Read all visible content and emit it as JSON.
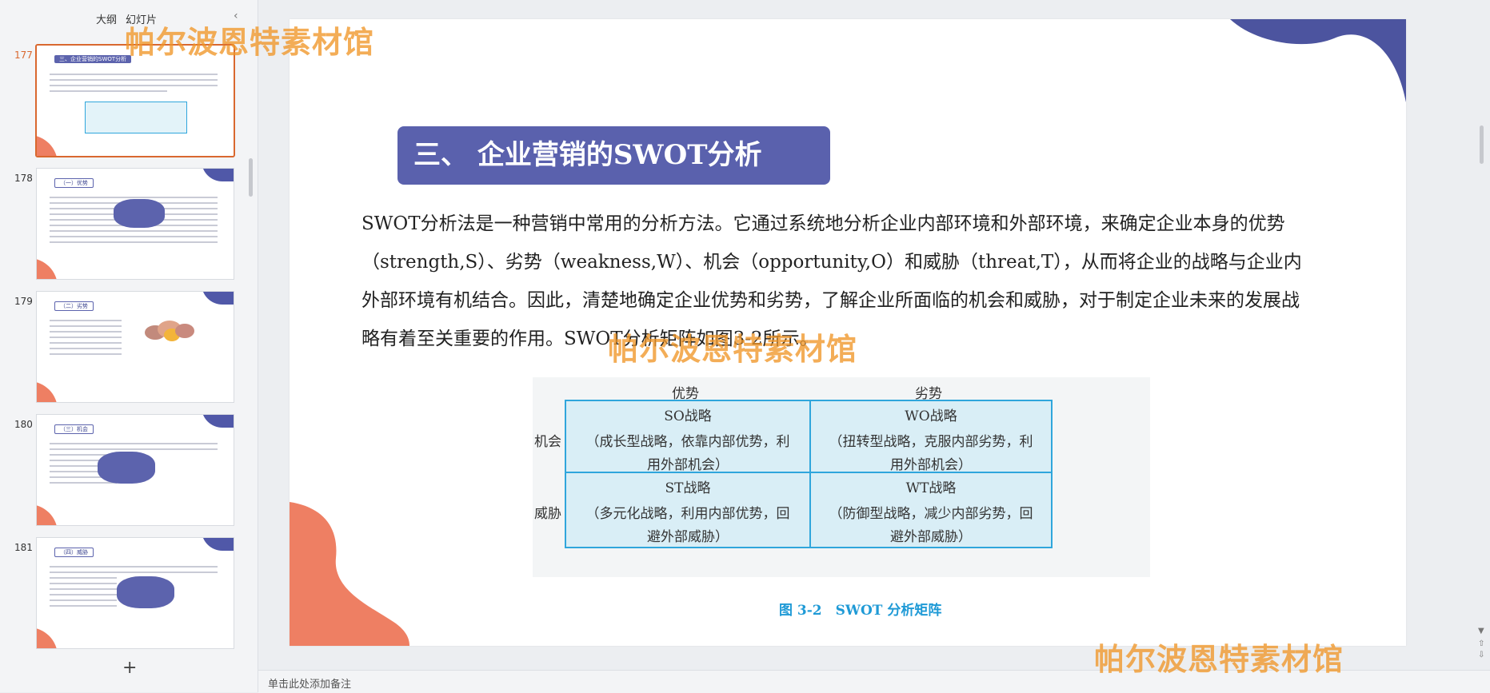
{
  "sidebar": {
    "tabs": [
      {
        "label": "大纲"
      },
      {
        "label": "幻灯片"
      }
    ],
    "collapse_icon": "chevron-left-icon",
    "thumbnails": [
      {
        "number": "177",
        "title": "三、企业营销的SWOT分析",
        "active": true
      },
      {
        "number": "178",
        "title": "（一）优势",
        "active": false
      },
      {
        "number": "179",
        "title": "（二）劣势",
        "active": false
      },
      {
        "number": "180",
        "title": "（三）机会",
        "active": false
      },
      {
        "number": "181",
        "title": "（四）威胁",
        "active": false
      }
    ],
    "add_label": "+"
  },
  "slide": {
    "title": "三、 企业营销的SWOT分析",
    "body": "SWOT分析法是一种营销中常用的分析方法。它通过系统地分析企业内部环境和外部环境，来确定企业本身的优势（strength,S）、劣势（weakness,W）、机会（opportunity,O）和威胁（threat,T），从而将企业的战略与企业内外部环境有机结合。因此，清楚地确定企业优势和劣势，了解企业所面临的机会和威胁，对于制定企业未来的发展战略有着至关重要的作用。SWOT分析矩阵如图3-2所示。",
    "matrix": {
      "col_headers": [
        "优势",
        "劣势"
      ],
      "row_headers": [
        "机会",
        "威胁"
      ],
      "cells": [
        {
          "name": "SO战略",
          "desc": "（成长型战略，依靠内部优势，利用外部机会）"
        },
        {
          "name": "WO战略",
          "desc": "（扭转型战略，克服内部劣势，利用外部机会）"
        },
        {
          "name": "ST战略",
          "desc": "（多元化战略，利用内部优势，回避外部威胁）"
        },
        {
          "name": "WT战略",
          "desc": "（防御型战略，减少内部劣势，回避外部威胁）"
        }
      ]
    },
    "caption": "图 3-2　SWOT 分析矩阵"
  },
  "watermark": "帕尔波恩特素材馆",
  "notes": {
    "placeholder": "单击此处添加备注"
  },
  "colors": {
    "title_bg": "#5a61ad",
    "blob_blue": "#4c549f",
    "blob_orange": "#ee7f63",
    "matrix_border": "#2fa6dc",
    "matrix_fill": "#d9eef6",
    "caption": "#1f9ad6",
    "active_thumb": "#d9682f"
  }
}
